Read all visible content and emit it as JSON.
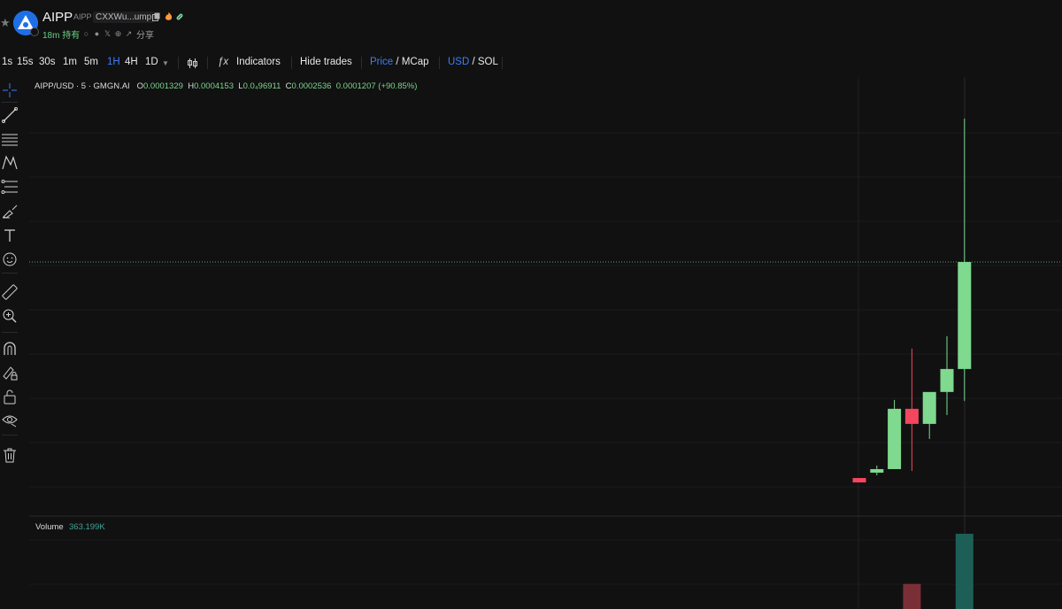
{
  "header": {
    "name": "AIPP",
    "symbol": "AIPP",
    "address": "CXXWu...ump",
    "hold_time": "18m 持有",
    "share": "分享"
  },
  "toolbar": {
    "intervals": [
      "1s",
      "15s",
      "30s",
      "1m",
      "5m",
      "1H",
      "4H",
      "1D"
    ],
    "active_interval": "1H",
    "indicators": "Indicators",
    "hide_trades": "Hide trades",
    "price": "Price",
    "slash1": "/",
    "mcap": "MCap",
    "usd": "USD",
    "slash2": "/",
    "sol": "SOL"
  },
  "legend": {
    "pair": "AIPP/USD · 5 · GMGN.AI",
    "o_label": "O",
    "o_val": "0.0001329",
    "h_label": "H",
    "h_val": "0.0004153",
    "l_label": "L",
    "l_val": "0.0₄96911",
    "c_label": "C",
    "c_val": "0.0002536",
    "change": "0.0001207 (+90.85%)"
  },
  "volume": {
    "label": "Volume",
    "value": "363.199K"
  },
  "colors": {
    "up": "#7fd98f",
    "down": "#f3475f",
    "vol_up": "#1d5f56",
    "vol_down": "#7a2f36",
    "accent": "#3d7df7"
  },
  "icons": [
    "crosshair-icon",
    "trend-line-icon",
    "horizontal-lines-icon",
    "pattern-icon",
    "fib-icon",
    "brush-icon",
    "text-icon",
    "emoji-icon",
    "ruler-icon",
    "zoom-in-icon",
    "magnet-icon",
    "lock-draw-icon",
    "lock-icon",
    "eye-icon",
    "trash-icon"
  ],
  "chart_data": {
    "type": "candlestick",
    "price_line": 0.0002536,
    "candles": [
      {
        "o": 9.98e-06,
        "h": 9.98e-06,
        "l": 5e-06,
        "c": 5e-06
      },
      {
        "o": 1.6e-05,
        "h": 2.4e-05,
        "l": 1.3e-05,
        "c": 2e-05
      },
      {
        "o": 2e-05,
        "h": 9.8e-05,
        "l": 2e-05,
        "c": 8.8e-05
      },
      {
        "o": 8.8e-05,
        "h": 0.000156,
        "l": 1.8e-05,
        "c": 7.1e-05
      },
      {
        "o": 7.1e-05,
        "h": 0.000105,
        "l": 5.4e-05,
        "c": 0.000107
      },
      {
        "o": 0.000107,
        "h": 0.00017,
        "l": 8.1e-05,
        "c": 0.0001329
      },
      {
        "o": 0.0001329,
        "h": 0.0004153,
        "l": 9.69e-05,
        "c": 0.0002536
      }
    ],
    "volume": [
      {
        "v": 0,
        "dir": "up"
      },
      {
        "v": 0,
        "dir": "up"
      },
      {
        "v": 0,
        "dir": "up"
      },
      {
        "v": 121000,
        "dir": "down"
      },
      {
        "v": 0,
        "dir": "up"
      },
      {
        "v": 0,
        "dir": "up"
      },
      {
        "v": 363199,
        "dir": "up"
      }
    ]
  }
}
